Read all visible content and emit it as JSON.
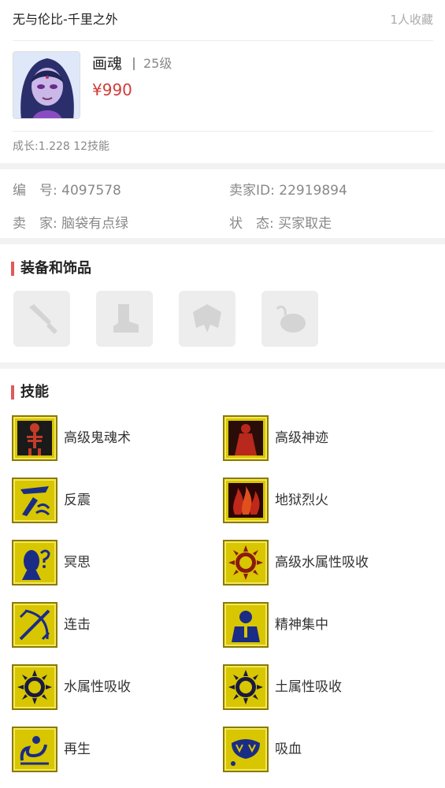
{
  "listing": {
    "server": "无与伦比-千里之外",
    "favorites": "1人收藏"
  },
  "pet": {
    "name": "画魂",
    "level": "25级",
    "price": "¥990",
    "growth": "成长:1.228 12技能"
  },
  "info": {
    "id_label": "编　号:",
    "id_value": "4097578",
    "seller_id_label": "卖家ID:",
    "seller_id_value": "22919894",
    "seller_label": "卖　家:",
    "seller_value": "脑袋有点绿",
    "status_label": "状　态:",
    "status_value": "买家取走"
  },
  "equipment": {
    "title": "装备和饰品",
    "slots": [
      "sword-icon",
      "boot-icon",
      "armor-icon",
      "accessory-icon"
    ]
  },
  "skills": {
    "title": "技能",
    "items": [
      {
        "name": "高级鬼魂术",
        "icon": "skeleton-icon"
      },
      {
        "name": "高级神迹",
        "icon": "divine-figure-icon"
      },
      {
        "name": "反震",
        "icon": "counter-shock-icon"
      },
      {
        "name": "地狱烈火",
        "icon": "hellfire-icon"
      },
      {
        "name": "冥思",
        "icon": "meditation-icon"
      },
      {
        "name": "高级水属性吸收",
        "icon": "water-absorb-icon"
      },
      {
        "name": "连击",
        "icon": "combo-attack-icon"
      },
      {
        "name": "精神集中",
        "icon": "focus-icon"
      },
      {
        "name": "水属性吸收",
        "icon": "water-absorb-icon"
      },
      {
        "name": "土属性吸收",
        "icon": "earth-absorb-icon"
      },
      {
        "name": "再生",
        "icon": "regenerate-icon"
      },
      {
        "name": "吸血",
        "icon": "vampire-icon"
      }
    ]
  },
  "colors": {
    "price": "#d23b38",
    "accent_bar": "#e05a5a",
    "skill_icon_bg": "#d8c600",
    "skill_icon_ink": "#1a2c86"
  }
}
